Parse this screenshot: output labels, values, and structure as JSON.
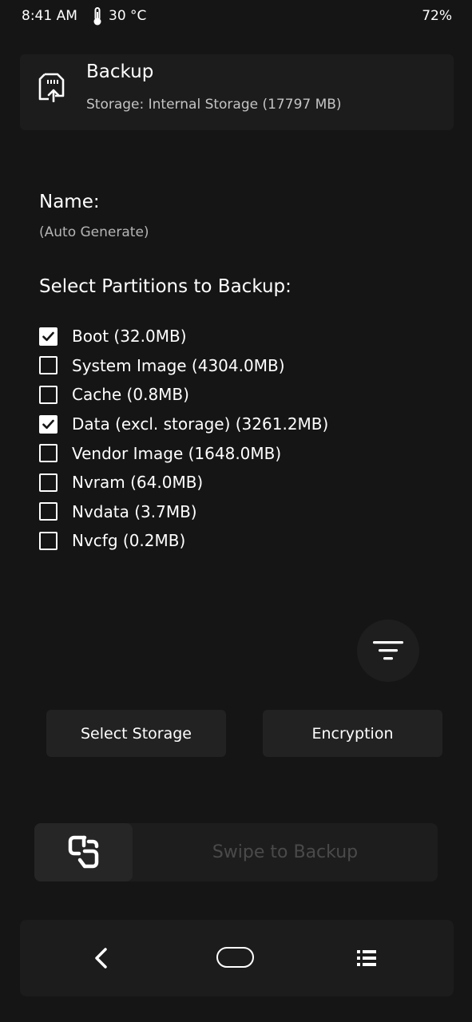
{
  "status_bar": {
    "time": "8:41 AM",
    "temperature": "30 °C",
    "battery": "72%",
    "icons": [
      "thermometer-icon"
    ]
  },
  "header": {
    "title": "Backup",
    "subtitle": "Storage: Internal Storage (17797 MB)",
    "icon": "sd-card-upload-icon"
  },
  "name_section": {
    "label": "Name:",
    "value": "(Auto Generate)"
  },
  "partitions": {
    "title": "Select Partitions to Backup:",
    "items": [
      {
        "label": "Boot (32.0MB)",
        "checked": true
      },
      {
        "label": "System Image (4304.0MB)",
        "checked": false
      },
      {
        "label": "Cache (0.8MB)",
        "checked": false
      },
      {
        "label": "Data (excl. storage) (3261.2MB)",
        "checked": true
      },
      {
        "label": "Vendor Image (1648.0MB)",
        "checked": false
      },
      {
        "label": "Nvram (64.0MB)",
        "checked": false
      },
      {
        "label": "Nvdata (3.7MB)",
        "checked": false
      },
      {
        "label": "Nvcfg (0.2MB)",
        "checked": false
      }
    ]
  },
  "filter_button": {
    "icon": "filter-icon"
  },
  "buttons": {
    "select_storage": "Select Storage",
    "encryption": "Encryption"
  },
  "swipe": {
    "label": "Swipe to Backup",
    "icon": "twrp-logo-icon"
  },
  "nav_bar": {
    "icons": [
      "back-icon",
      "home-icon",
      "menu-icon"
    ]
  },
  "colors": {
    "background": "#151515",
    "card": "#1c1c1c",
    "button": "#222222",
    "text": "#ffffff",
    "muted_text": "#c4c4c4",
    "swipe_text": "#4a4a4a"
  }
}
